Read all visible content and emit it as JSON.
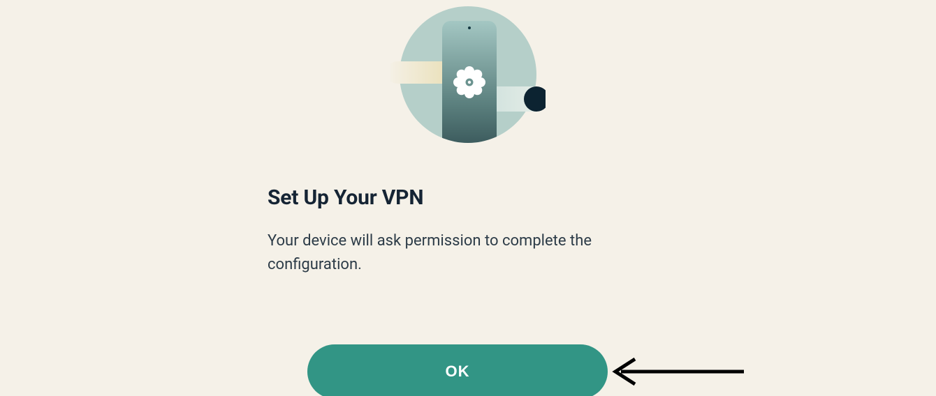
{
  "title": "Set Up Your VPN",
  "description": "Your device will ask permission to complete the configuration.",
  "primary_button_label": "OK",
  "icons": {
    "illustration": "vpn-setup-illustration",
    "button_hint": "pointer-arrow"
  },
  "colors": {
    "background": "#f5f1e8",
    "text_primary": "#152434",
    "text_body": "#2c3b47",
    "button_bg": "#329585",
    "button_text": "#ffffff",
    "illustration_circle": "#b5cfc9",
    "illustration_phone_top": "#8fb8b4",
    "illustration_phone_bottom": "#3e5a5d",
    "illustration_pill_left": "#f1e7c6",
    "illustration_dot_right": "#0c2331"
  }
}
